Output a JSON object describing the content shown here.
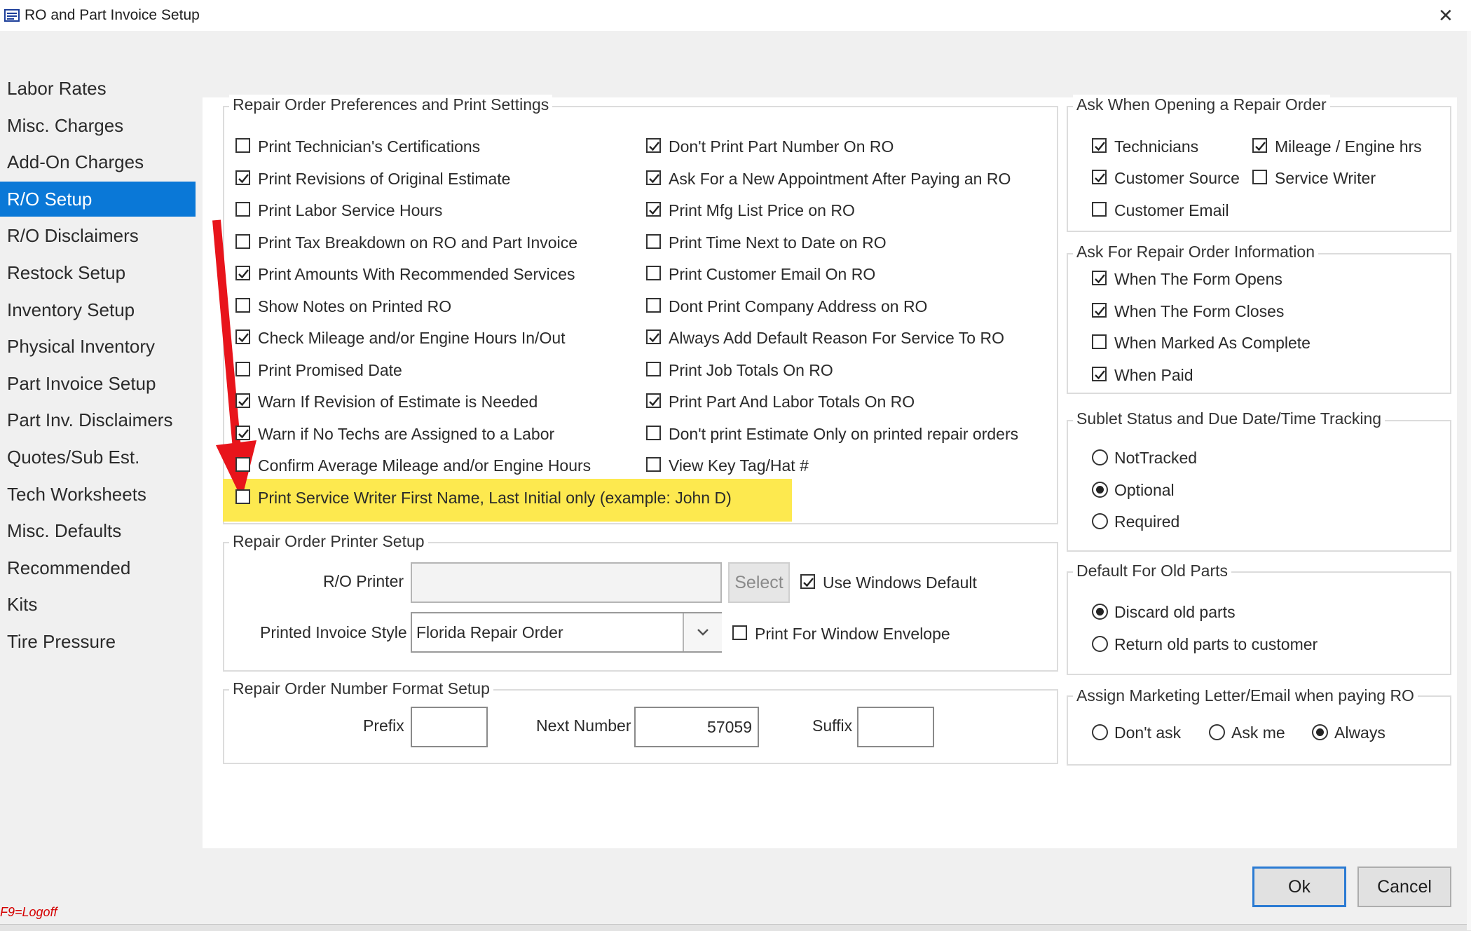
{
  "window": {
    "title": "RO and Part Invoice Setup",
    "close_glyph": "✕"
  },
  "sidebar": {
    "items": [
      {
        "label": "Labor Rates"
      },
      {
        "label": "Misc. Charges"
      },
      {
        "label": "Add-On Charges"
      },
      {
        "label": "R/O Setup",
        "selected": true
      },
      {
        "label": "R/O Disclaimers"
      },
      {
        "label": "Restock Setup"
      },
      {
        "label": "Inventory Setup"
      },
      {
        "label": "Physical Inventory"
      },
      {
        "label": "Part Invoice Setup"
      },
      {
        "label": "Part Inv. Disclaimers"
      },
      {
        "label": "Quotes/Sub Est."
      },
      {
        "label": "Tech Worksheets"
      },
      {
        "label": "Misc. Defaults"
      },
      {
        "label": "Recommended"
      },
      {
        "label": "Kits"
      },
      {
        "label": "Tire Pressure"
      }
    ]
  },
  "prefs": {
    "title": "Repair Order Preferences and Print Settings",
    "left": [
      {
        "label": "Print Technician's Certifications",
        "checked": false
      },
      {
        "label": "Print Revisions of Original Estimate",
        "checked": true
      },
      {
        "label": "Print Labor Service Hours",
        "checked": false
      },
      {
        "label": "Print Tax Breakdown on RO and Part Invoice",
        "checked": false
      },
      {
        "label": "Print Amounts With Recommended Services",
        "checked": true
      },
      {
        "label": "Show Notes on Printed RO",
        "checked": false
      },
      {
        "label": "Check Mileage and/or Engine Hours In/Out",
        "checked": true
      },
      {
        "label": "Print Promised Date",
        "checked": false
      },
      {
        "label": "Warn If Revision of Estimate is Needed",
        "checked": true
      },
      {
        "label": "Warn if No Techs are Assigned to a Labor",
        "checked": true
      },
      {
        "label": "Confirm Average Mileage and/or Engine Hours",
        "checked": false
      },
      {
        "label": "Print Service Writer First Name, Last Initial only (example: John D)",
        "checked": false
      }
    ],
    "right": [
      {
        "label": "Don't Print Part Number On RO",
        "checked": true
      },
      {
        "label": "Ask For a New Appointment After Paying an RO",
        "checked": true
      },
      {
        "label": "Print Mfg List Price on RO",
        "checked": true
      },
      {
        "label": "Print Time Next to Date on RO",
        "checked": false
      },
      {
        "label": "Print Customer Email On RO",
        "checked": false
      },
      {
        "label": "Dont Print Company Address on RO",
        "checked": false
      },
      {
        "label": "Always Add Default Reason For Service To RO",
        "checked": true
      },
      {
        "label": "Print Job Totals On RO",
        "checked": false
      },
      {
        "label": "Print Part And Labor Totals On RO",
        "checked": true
      },
      {
        "label": "Don't print Estimate Only on printed repair orders",
        "checked": false
      },
      {
        "label": "View Key Tag/Hat #",
        "checked": false
      }
    ]
  },
  "printer": {
    "title": "Repair Order Printer Setup",
    "ro_printer_label": "R/O Printer",
    "ro_printer_value": "",
    "select_label": "Select",
    "use_windows_default": {
      "label": "Use Windows Default",
      "checked": true
    },
    "invoice_style_label": "Printed Invoice Style",
    "invoice_style_value": "Florida Repair Order",
    "window_envelope": {
      "label": "Print For Window Envelope",
      "checked": false
    }
  },
  "number_format": {
    "title": "Repair Order Number Format Setup",
    "prefix_label": "Prefix",
    "prefix_value": "",
    "next_label": "Next Number",
    "next_value": "57059",
    "suffix_label": "Suffix",
    "suffix_value": ""
  },
  "ask_opening": {
    "title": "Ask When Opening a Repair Order",
    "items": [
      {
        "label": "Technicians",
        "checked": true
      },
      {
        "label": "Mileage / Engine hrs",
        "checked": true
      },
      {
        "label": "Customer Source",
        "checked": true
      },
      {
        "label": "Service Writer",
        "checked": false
      },
      {
        "label": "Customer Email",
        "checked": false
      }
    ]
  },
  "ask_info": {
    "title": "Ask For Repair Order Information",
    "items": [
      {
        "label": "When The Form Opens",
        "checked": true
      },
      {
        "label": "When The Form Closes",
        "checked": true
      },
      {
        "label": "When Marked As Complete",
        "checked": false
      },
      {
        "label": "When Paid",
        "checked": true
      }
    ]
  },
  "sublet": {
    "title": "Sublet Status and Due Date/Time Tracking",
    "options": [
      {
        "label": "NotTracked",
        "selected": false
      },
      {
        "label": "Optional",
        "selected": true
      },
      {
        "label": "Required",
        "selected": false
      }
    ]
  },
  "old_parts": {
    "title": "Default For Old Parts",
    "options": [
      {
        "label": "Discard old parts",
        "selected": true
      },
      {
        "label": "Return old parts to customer",
        "selected": false
      }
    ]
  },
  "marketing": {
    "title": "Assign Marketing Letter/Email when paying RO",
    "options": [
      {
        "label": "Don't ask",
        "selected": false
      },
      {
        "label": "Ask me",
        "selected": false
      },
      {
        "label": "Always",
        "selected": true
      }
    ]
  },
  "buttons": {
    "ok": "Ok",
    "cancel": "Cancel"
  },
  "footer": {
    "logoff": "F9=Logoff"
  },
  "colors": {
    "selection": "#0a78d7",
    "highlight": "#fde94f",
    "arrow": "#e8141b"
  }
}
